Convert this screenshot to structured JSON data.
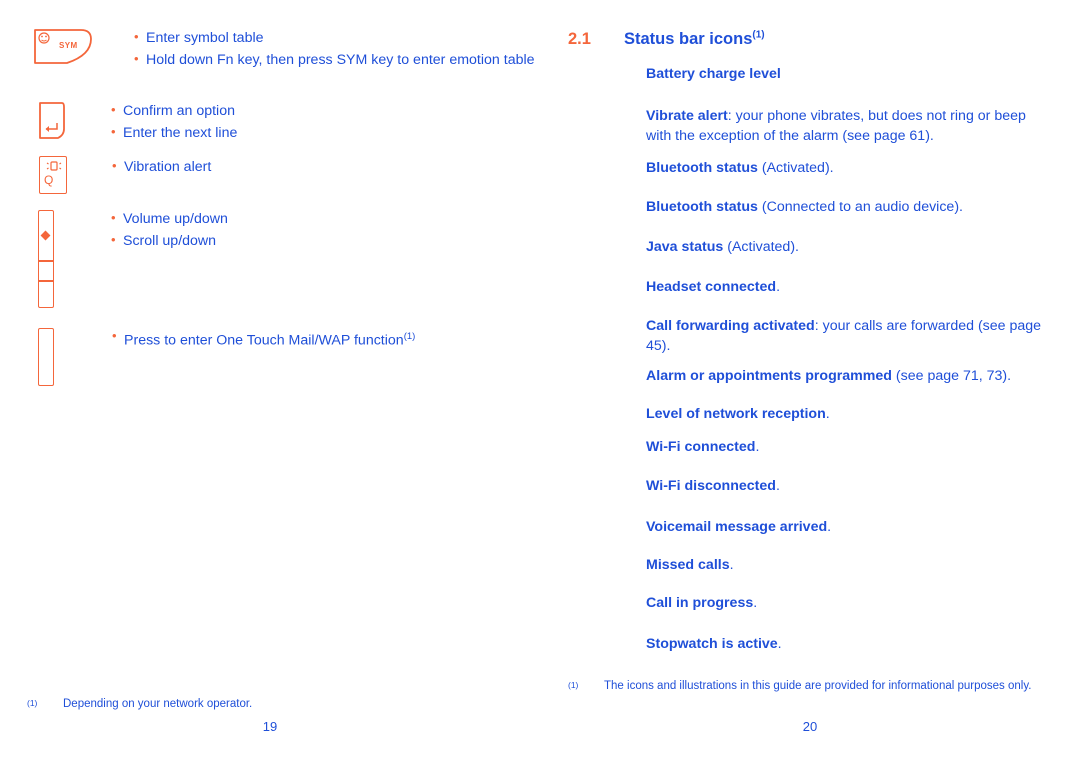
{
  "left_page": {
    "page_number": "19",
    "footnote": {
      "marker": "(1)",
      "text": "Depending on your network operator."
    },
    "key_rows": [
      {
        "key": {
          "name": "sym-key",
          "label": "SYM",
          "glyph": "smiley-face-icon"
        },
        "bullets": [
          "Enter symbol table",
          "Hold down Fn key, then press SYM key to enter emotion table"
        ]
      },
      {
        "key": {
          "name": "enter-key",
          "label": "",
          "glyph": "enter-arrow-icon"
        },
        "bullets": [
          "Confirm an option",
          "Enter the next line"
        ]
      },
      {
        "key": {
          "name": "vibration-q-key",
          "label": "Q",
          "glyph": "vibration-icon"
        },
        "bullets": [
          "Vibration alert"
        ]
      },
      {
        "key": {
          "name": "volume-side-key",
          "label": "",
          "glyph": "diamond-marker-icon"
        },
        "bullets": [
          "Volume up/down",
          "Scroll up/down"
        ]
      },
      {
        "key": {
          "name": "one-touch-side-key",
          "label": "",
          "glyph": ""
        },
        "bullets": [
          "Press to enter One Touch Mail/WAP function"
        ],
        "bullet_superscript": "(1)"
      }
    ]
  },
  "right_page": {
    "page_number": "20",
    "section": {
      "number": "2.1",
      "title": "Status bar icons",
      "superscript": "(1)"
    },
    "items": [
      {
        "icon": "battery-icon",
        "bold": "Battery charge level",
        "rest": ""
      },
      {
        "icon": "vibrate-icon",
        "bold": "Vibrate alert",
        "rest": ": your phone vibrates, but does not ring or beep with the exception of the alarm (see page 61)."
      },
      {
        "icon": "bluetooth-icon",
        "bold": "Bluetooth status",
        "rest": " (Activated)."
      },
      {
        "icon": "bluetooth-audio-icon",
        "bold": "Bluetooth status",
        "rest": " (Connected to an audio device)."
      },
      {
        "icon": "java-icon",
        "bold": "Java status",
        "rest": " (Activated)."
      },
      {
        "icon": "headset-icon",
        "bold": "Headset connected",
        "rest": "."
      },
      {
        "icon": "call-forwarding-icon",
        "bold": "Call forwarding activated",
        "rest": ": your calls are forwarded (see page 45)."
      },
      {
        "icon": "alarm-icon",
        "bold": "Alarm or appointments programmed",
        "rest": " (see page 71, 73)."
      },
      {
        "icon": "signal-strength-icon",
        "bold": "Level of network reception",
        "rest": "."
      },
      {
        "icon": "wifi-connected-icon",
        "bold": "Wi-Fi connected",
        "rest": "."
      },
      {
        "icon": "wifi-disconnected-icon",
        "bold": "Wi-Fi disconnected",
        "rest": "."
      },
      {
        "icon": "voicemail-icon",
        "bold": "Voicemail message arrived",
        "rest": "."
      },
      {
        "icon": "missed-calls-icon",
        "bold": "Missed calls",
        "rest": "."
      },
      {
        "icon": "call-in-progress-icon",
        "bold": "Call in progress",
        "rest": "."
      },
      {
        "icon": "stopwatch-icon",
        "bold": "Stopwatch is active",
        "rest": "."
      }
    ],
    "footnote": {
      "marker": "(1)",
      "text": "The icons and illustrations in this guide are provided for informational purposes only."
    }
  },
  "colors": {
    "accent_orange": "#f4663b",
    "text_blue": "#1f4fd8",
    "background": "#ffffff"
  }
}
